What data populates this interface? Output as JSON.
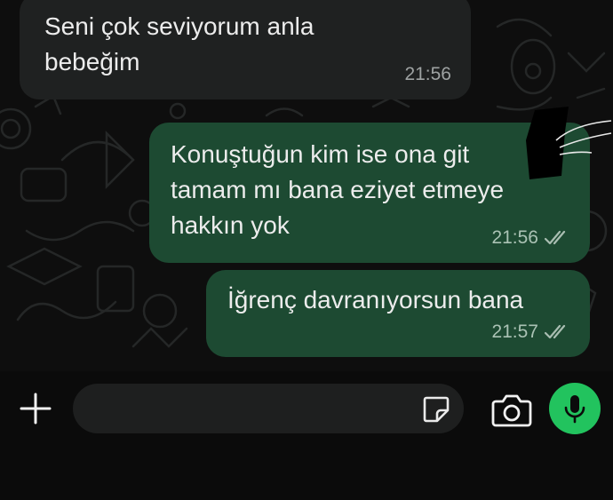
{
  "messages": [
    {
      "direction": "incoming",
      "text": "Seni çok seviyorum anla\nbebeğim",
      "time": "21:56"
    },
    {
      "direction": "outgoing",
      "text": "Konuştuğun kim ise ona git\ntamam mı bana eziyet etmeye\nhakkın yok",
      "time": "21:56",
      "status_icon": "double-check-icon"
    },
    {
      "direction": "outgoing",
      "text": "İğrenç davranıyorsun bana",
      "time": "21:57",
      "status_icon": "double-check-icon"
    }
  ],
  "composer": {
    "input_value": "",
    "input_placeholder": "",
    "icons": [
      "plus-icon",
      "sticker-icon",
      "camera-icon",
      "microphone-icon"
    ]
  },
  "colors": {
    "chat_background": "#0e0e0e",
    "incoming_bubble": "#1f2121",
    "outgoing_bubble": "#1d4a32",
    "mic_button": "#22c35e"
  }
}
